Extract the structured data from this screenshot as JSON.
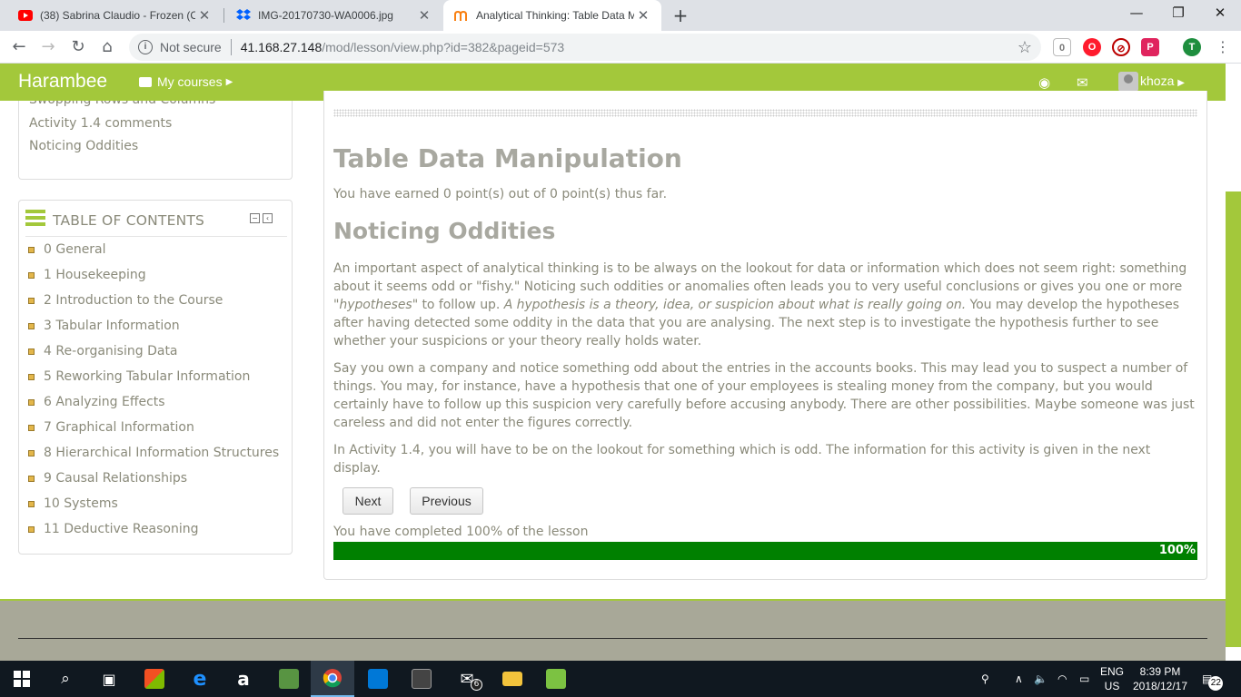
{
  "browser": {
    "tabs": [
      {
        "title": "(38) Sabrina Claudio - Frozen (Of",
        "icon": "youtube-icon"
      },
      {
        "title": "IMG-20170730-WA0006.jpg",
        "icon": "dropbox-icon"
      },
      {
        "title": "Analytical Thinking: Table Data M",
        "icon": "moodle-icon"
      }
    ],
    "new_tab": "+",
    "security": "Not secure",
    "url_host": "41.168.27.148",
    "url_path": "/mod/lesson/view.php?id=382&pageid=573",
    "profile_initial": "T",
    "ext_badge": "0"
  },
  "navbar": {
    "brand": "Harambee",
    "my_courses": "My courses",
    "username": "khoza"
  },
  "sidebar_block": {
    "items": [
      "Swopping Rows and Columns",
      "Activity 1.4 comments",
      "Noticing Oddities"
    ]
  },
  "toc": {
    "title": "TABLE OF CONTENTS",
    "items": [
      "0 General",
      "1 Housekeeping",
      "2 Introduction to the Course",
      "3 Tabular Information",
      "4 Re-organising Data",
      "5 Reworking Tabular Information",
      "6 Analyzing Effects",
      "7 Graphical Information",
      "8 Hierarchical Information Structures",
      "9 Causal Relationships",
      "10 Systems",
      "11 Deductive Reasoning"
    ]
  },
  "lesson": {
    "title": "Table Data Manipulation",
    "earned": "You have earned 0 point(s) out of 0 point(s) thus far.",
    "page_title": "Noticing Oddities",
    "p1_a": "An important aspect of analytical thinking is to be always on the lookout for data or information which does not seem right: something about it seems odd or \"fishy.\" Noticing such oddities or anomalies often leads you to very useful conclusions or gives you one or more \"",
    "p1_em1": "hypotheses",
    "p1_b": "\" to follow up. ",
    "p1_em2": "A hypothesis is a theory, idea, or suspicion about what is really going on.",
    "p1_c": " You may develop the hypotheses after having detected some oddity in the data that you are analysing. The next step is to investigate the hypothesis further to see whether your suspicions or your theory really holds water.",
    "p2": "Say you own a company and notice something odd about the entries in the accounts books. This may lead you to suspect a number of things. You may, for instance, have a hypothesis that one of your employees is stealing money from the company, but you would certainly have to follow up this suspicion very carefully before accusing anybody. There are other possibilities. Maybe someone was just careless and did not enter the figures correctly.",
    "p3": "In Activity 1.4, you will have to be on the lookout for something which is odd. The information for this activity is given in the next display.",
    "next": "Next",
    "previous": "Previous",
    "completed": "You have completed 100% of the lesson",
    "progress_label": "100%",
    "progress": 1.0
  },
  "taskbar": {
    "lang1": "ENG",
    "lang2": "US",
    "time": "8:39 PM",
    "date": "2018/12/17",
    "notifications": "22",
    "mail_badge": "6"
  },
  "colors": {
    "brand_green": "#a3c83b",
    "progress_green": "#008000",
    "footer": "#a8a898"
  }
}
